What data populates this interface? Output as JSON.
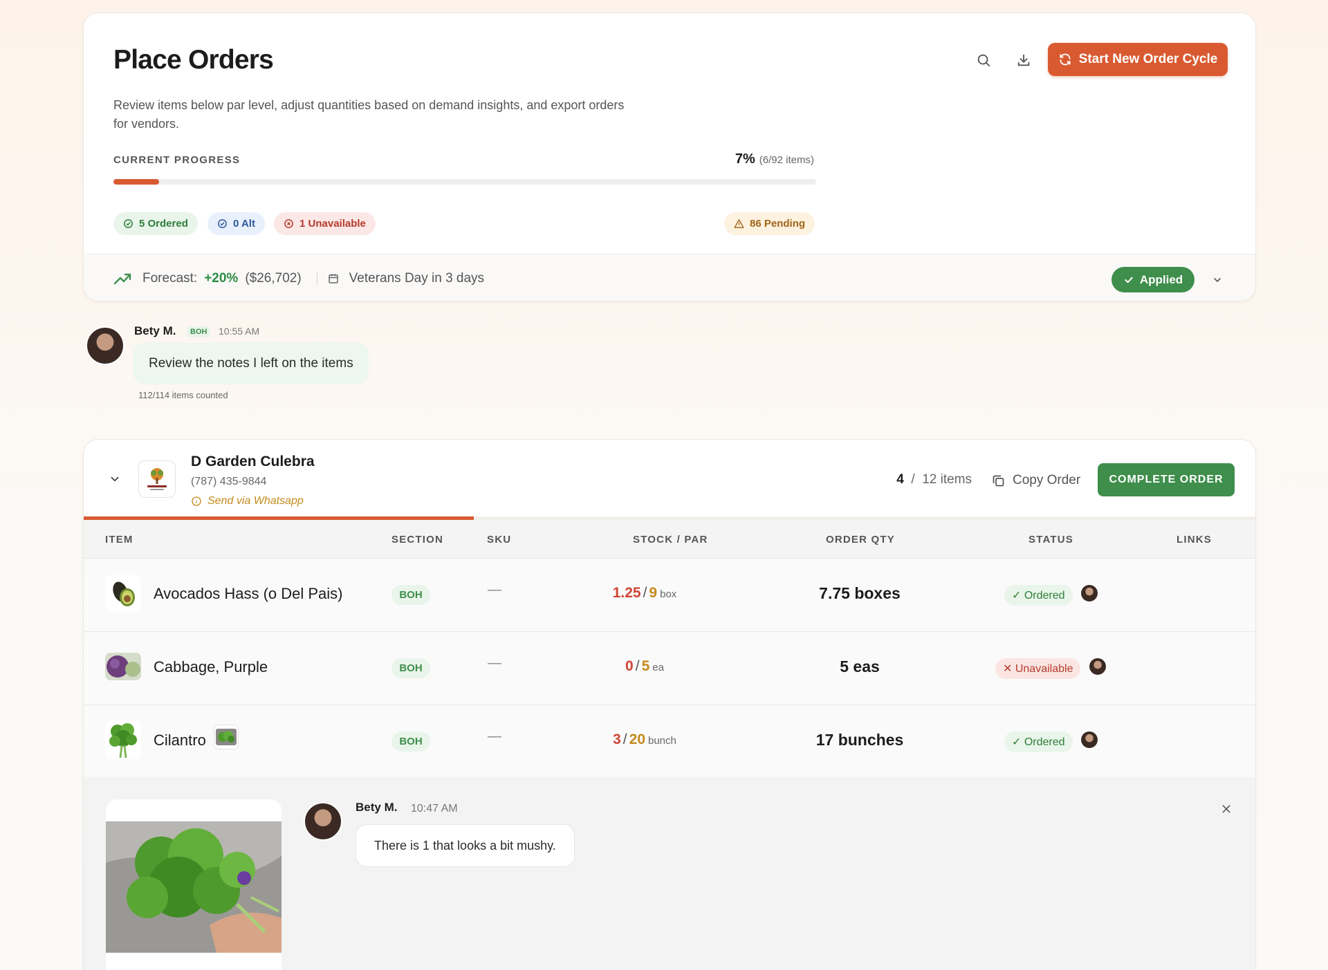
{
  "header": {
    "title": "Place Orders",
    "subtitle": "Review items below par level, adjust quantities based on demand insights, and export orders for vendors.",
    "start_cycle_label": "Start New Order Cycle"
  },
  "progress": {
    "label": "CURRENT PROGRESS",
    "percent_text": "7%",
    "items_text": "(6/92 items)",
    "fraction": 0.065,
    "pills": {
      "ordered": "5 Ordered",
      "alt": "0 Alt",
      "unavailable": "1 Unavailable",
      "pending": "86 Pending"
    }
  },
  "forecast": {
    "label": "Forecast:",
    "change": "+20%",
    "amount": "($26,702)",
    "event": "Veterans Day in 3 days",
    "applied_label": "Applied"
  },
  "comment1": {
    "author": "Bety M.",
    "tag": "BOH",
    "time": "10:55 AM",
    "text": "Review the notes I left on the items",
    "meta": "112/114 items counted"
  },
  "vendor": {
    "name": "D Garden Culebra",
    "phone": "(787) 435-9844",
    "send_label": "Send via Whatsapp",
    "count_done": "4",
    "count_total": "12 items",
    "copy_label": "Copy Order",
    "complete_label": "COMPLETE ORDER",
    "progress_fraction": 0.333,
    "columns": [
      "ITEM",
      "SECTION",
      "SKU",
      "STOCK / PAR",
      "ORDER QTY",
      "STATUS",
      "LINKS"
    ],
    "rows": [
      {
        "name": "Avocados Hass (o Del Pais)",
        "section": "BOH",
        "sku": "—",
        "stock": "1.25",
        "par": "9",
        "unit": "box",
        "qty": "7.75 boxes",
        "status": "✓ Ordered",
        "status_type": "ok"
      },
      {
        "name": "Cabbage, Purple",
        "section": "BOH",
        "sku": "—",
        "stock": "0",
        "par": "5",
        "unit": "ea",
        "qty": "5 eas",
        "status": "✕ Unavailable",
        "status_type": "bad"
      },
      {
        "name": "Cilantro",
        "section": "BOH",
        "sku": "—",
        "stock": "3",
        "par": "20",
        "unit": "bunch",
        "qty": "17 bunches",
        "status": "✓ Ordered",
        "status_type": "ok"
      }
    ]
  },
  "comment2": {
    "author": "Bety M.",
    "time": "10:47 AM",
    "text": "There is 1 that looks a bit mushy."
  },
  "colors": {
    "accent": "#d95a31",
    "success": "#3f8e4c",
    "danger": "#d04535",
    "warning": "#c48a1c"
  }
}
